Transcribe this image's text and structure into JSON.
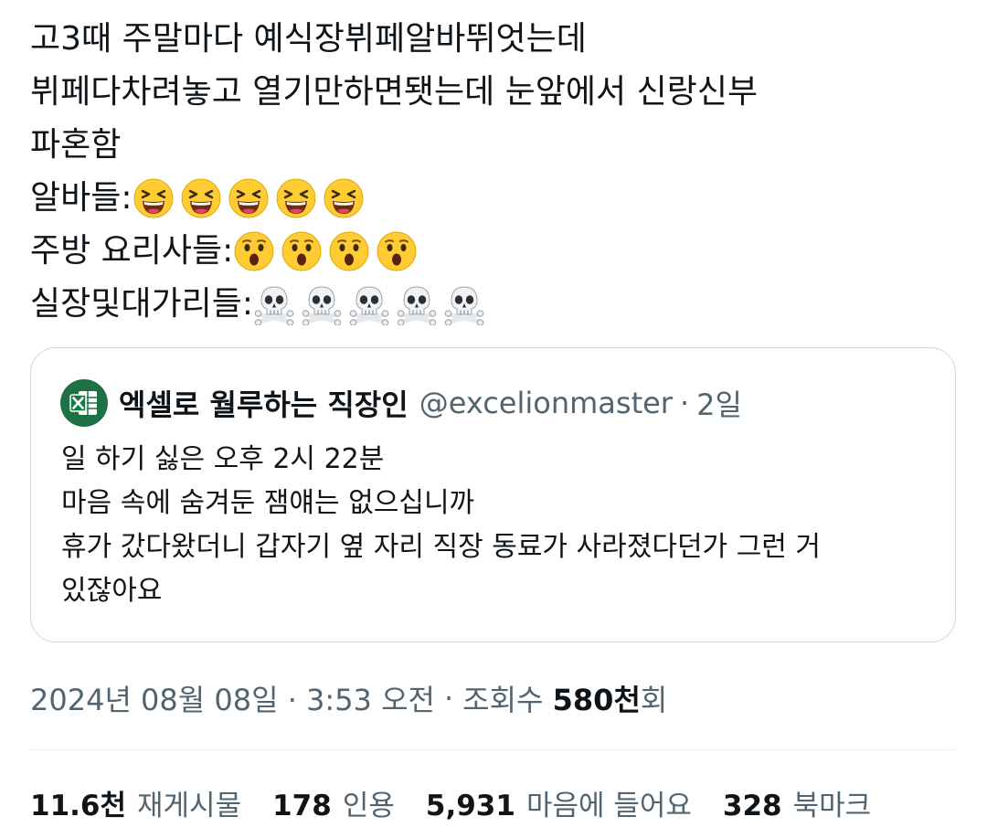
{
  "tweet": {
    "lines": [
      "고3때 주말마다 예식장뷔페알바뛰엇는데",
      "뷔페다차려놓고 열기만하면됏는데 눈앞에서 신랑신부",
      "파혼함"
    ],
    "reactions": [
      {
        "label": "알바들:",
        "emoji": "laughing-face",
        "count": 5
      },
      {
        "label": "주방 요리사들:",
        "emoji": "astonished-face",
        "count": 4
      },
      {
        "label": "실장및대가리들:",
        "emoji": "skull-and-crossbones",
        "count": 5
      }
    ]
  },
  "quote": {
    "display_name": "엑셀로 월루하는 직장인",
    "handle": "@excelionmaster",
    "dot": "·",
    "time": "2일",
    "avatar_icon": "excel-logo-icon",
    "lines": [
      "일 하기 싫은 오후 2시 22분",
      "마음 속에 숨겨둔 잼얘는 없으십니까",
      "휴가 갔다왔더니 갑자기 옆 자리 직장 동료가 사라졌다던가 그런 거",
      "있잖아요"
    ]
  },
  "meta": {
    "datetime": "2024년 08월 08일 · 3:53 오전",
    "sep": "·",
    "views_label": "조회수",
    "views_count": "580천",
    "views_suffix": "회"
  },
  "stats": {
    "retweets": {
      "count": "11.6천",
      "label": "재게시물"
    },
    "quotes": {
      "count": "178",
      "label": "인용"
    },
    "likes": {
      "count": "5,931",
      "label": "마음에 들어요"
    },
    "bookmarks": {
      "count": "328",
      "label": "북마크"
    }
  },
  "colors": {
    "text_primary": "#0f1419",
    "text_secondary": "#536471",
    "border": "#cfd9de",
    "excel_green": "#1e7145",
    "emoji_yellow": "#ffcc33"
  }
}
